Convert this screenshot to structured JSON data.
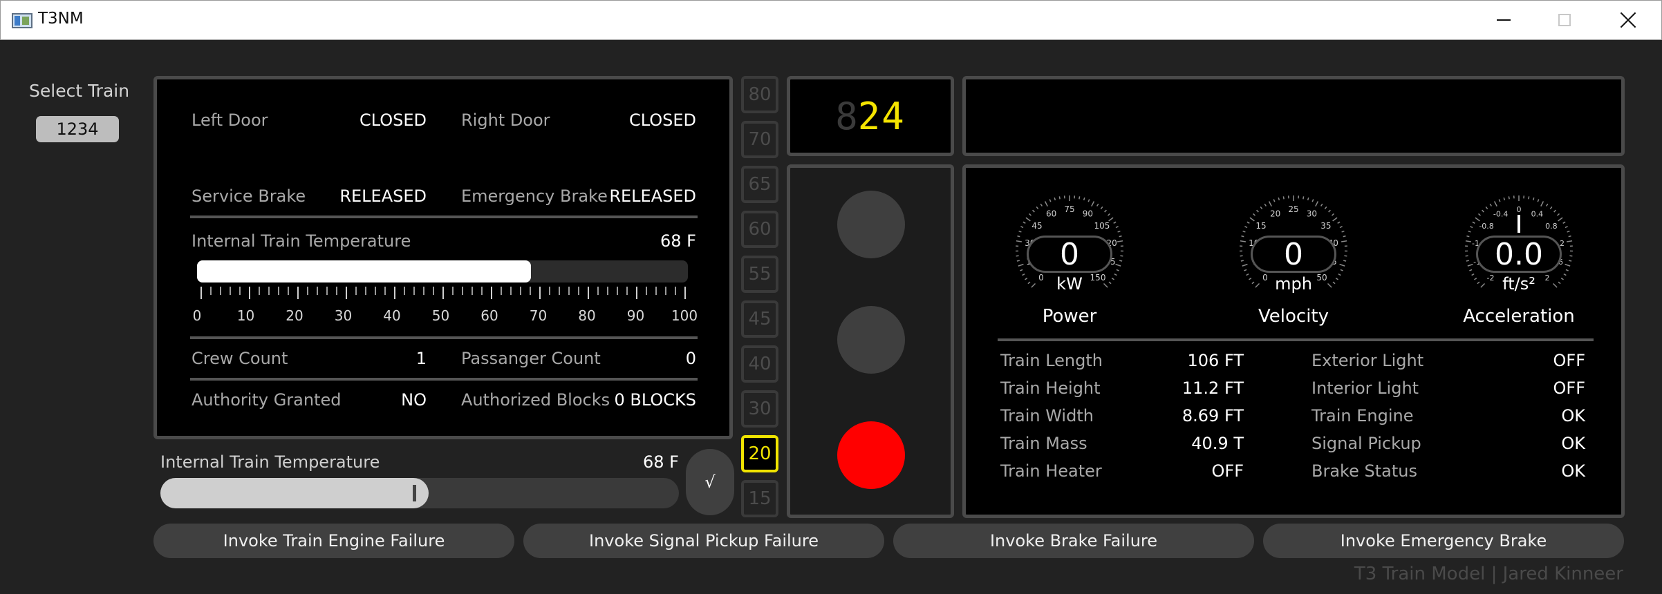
{
  "window": {
    "title": "T3NM"
  },
  "sidebar": {
    "select_label": "Select Train",
    "selected_train": "1234"
  },
  "status": {
    "left_door_label": "Left Door",
    "left_door_value": "CLOSED",
    "right_door_label": "Right Door",
    "right_door_value": "CLOSED",
    "service_brake_label": "Service Brake",
    "service_brake_value": "RELEASED",
    "emergency_brake_label": "Emergency Brake",
    "emergency_brake_value": "RELEASED",
    "temp_label": "Internal Train Temperature",
    "temp_value": "68 F",
    "temp_level_percent": 68,
    "temp_scale": [
      "0",
      "10",
      "20",
      "30",
      "40",
      "50",
      "60",
      "70",
      "80",
      "90",
      "100"
    ],
    "crew_label": "Crew Count",
    "crew_value": "1",
    "passenger_label": "Passanger Count",
    "passenger_value": "0",
    "authority_label": "Authority Granted",
    "authority_value": "NO",
    "blocks_label": "Authorized Blocks",
    "blocks_value": "0 BLOCKS"
  },
  "speed_limits": [
    "80",
    "70",
    "65",
    "60",
    "55",
    "45",
    "40",
    "30",
    "20",
    "15"
  ],
  "speed_limit_active": "20",
  "segment_display": {
    "ghost": "8",
    "digits": "24",
    "color": "#f5e400"
  },
  "signal_lights": {
    "active": "red",
    "red_color": "#ff0000"
  },
  "gauges": {
    "power": {
      "title": "Power",
      "value": "0",
      "unit": "kW",
      "ticks": [
        "0",
        "15",
        "30",
        "45",
        "60",
        "75",
        "90",
        "105",
        "120",
        "135",
        "150"
      ]
    },
    "velocity": {
      "title": "Velocity",
      "value": "0",
      "unit": "mph",
      "ticks": [
        "0",
        "5",
        "10",
        "15",
        "20",
        "25",
        "30",
        "35",
        "40",
        "45",
        "50"
      ]
    },
    "acceleration": {
      "title": "Acceleration",
      "value": "0.0",
      "unit": "ft/s²",
      "ticks": [
        "-2",
        "-1.6",
        "-1.2",
        "-0.8",
        "-0.4",
        "0",
        "0.4",
        "0.8",
        "1.2",
        "1.6",
        "2"
      ]
    }
  },
  "specs_left": [
    {
      "label": "Train Length",
      "value": "106 FT"
    },
    {
      "label": "Train Height",
      "value": "11.2 FT"
    },
    {
      "label": "Train Width",
      "value": "8.69 FT"
    },
    {
      "label": "Train Mass",
      "value": "40.9 T"
    },
    {
      "label": "Train Heater",
      "value": "OFF"
    }
  ],
  "specs_right": [
    {
      "label": "Exterior Light",
      "value": "OFF"
    },
    {
      "label": "Interior Light",
      "value": "OFF"
    },
    {
      "label": "Train Engine",
      "value": "OK"
    },
    {
      "label": "Signal Pickup",
      "value": "OK"
    },
    {
      "label": "Brake Status",
      "value": "OK"
    }
  ],
  "temp_control": {
    "label": "Internal Train Temperature",
    "value": "68 F",
    "level_percent": 68,
    "confirm": "√"
  },
  "buttons": {
    "engine_failure": "Invoke Train Engine Failure",
    "signal_failure": "Invoke Signal Pickup Failure",
    "brake_failure": "Invoke Brake Failure",
    "emergency_brake": "Invoke Emergency Brake"
  },
  "footer": "T3 Train Model | Jared Kinneer"
}
